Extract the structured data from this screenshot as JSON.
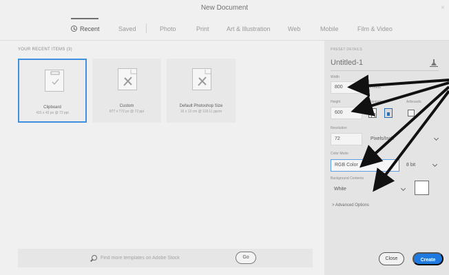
{
  "window": {
    "title": "New Document",
    "close_glyph": "×"
  },
  "tabs": [
    {
      "label": "Recent",
      "active": true,
      "icon": "clock-icon"
    },
    {
      "label": "Saved"
    },
    {
      "label": "Photo"
    },
    {
      "label": "Print"
    },
    {
      "label": "Art & Illustration"
    },
    {
      "label": "Web"
    },
    {
      "label": "Mobile"
    },
    {
      "label": "Film & Video"
    }
  ],
  "recent": {
    "heading": "YOUR RECENT ITEMS (3)",
    "items": [
      {
        "name": "Clipboard",
        "meta": "415 x 42 px @ 72 ppi",
        "icon": "clipboard-doc-icon",
        "selected": true
      },
      {
        "name": "Custom",
        "meta": "877 x 772 px @ 72 ppi",
        "icon": "doc-brush-icon"
      },
      {
        "name": "Default Photoshop Size",
        "meta": "16 x 12 cm @ 118.11 ppcm",
        "icon": "doc-brush-icon"
      }
    ]
  },
  "search": {
    "placeholder": "Find more templates on Adobe Stock",
    "go_label": "Go"
  },
  "preset": {
    "section_label": "PRESET DETAILS",
    "doc_name": "Untitled-1",
    "width_label": "Width",
    "width_value": "800",
    "width_unit": "Pixels",
    "height_label": "Height",
    "height_value": "600",
    "orientation_label": "Orientation",
    "artboards_label": "Artboards",
    "resolution_label": "Resolution",
    "resolution_value": "72",
    "resolution_unit": "Pixels/Inch",
    "color_mode_label": "Color Mode",
    "color_mode_value": "RGB Color",
    "bit_depth": "8 bit",
    "background_label": "Background Contents",
    "background_value": "White",
    "background_color": "#ffffff",
    "advanced_label": "> Advanced Options"
  },
  "buttons": {
    "close_label": "Close",
    "create_label": "Create"
  },
  "colors": {
    "accent": "#1f7ae0",
    "selection": "#3f8fe0"
  }
}
